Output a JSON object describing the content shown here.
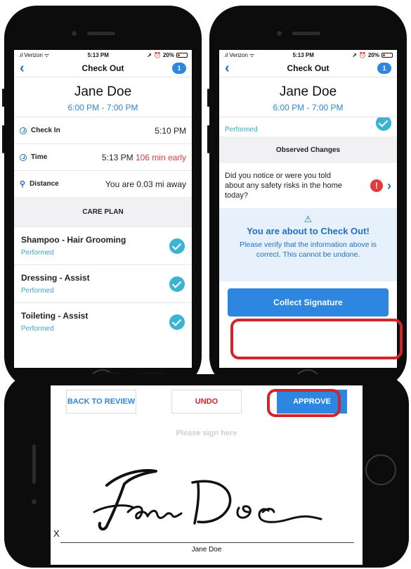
{
  "status_bar": {
    "carrier": "Verizon",
    "time": "5:13 PM",
    "battery": "20%"
  },
  "nav": {
    "title": "Check Out",
    "badge": "1"
  },
  "client": {
    "name": "Jane Doe",
    "time_range": "6:00 PM - 7:00 PM"
  },
  "visit": {
    "check_in_label": "Check In",
    "check_in_value": "5:10 PM",
    "time_label": "Time",
    "time_value": "5:13 PM",
    "time_early": "106 min early",
    "distance_label": "Distance",
    "distance_value": "You are 0.03 mi away"
  },
  "care_plan": {
    "header": "CARE PLAN",
    "items": [
      {
        "title": "Shampoo - Hair Grooming",
        "status": "Performed"
      },
      {
        "title": "Dressing - Assist",
        "status": "Performed"
      },
      {
        "title": "Toileting - Assist",
        "status": "Performed"
      }
    ],
    "partial_status": "Performed"
  },
  "observed_changes": {
    "header": "Observed Changes",
    "question": "Did you notice or were you told about any safety risks in the home today?",
    "alert_glyph": "!"
  },
  "warning": {
    "icon": "⚠",
    "title": "You are about to Check Out!",
    "body": "Please verify that the information above is correct. This cannot be undone."
  },
  "collect_signature_label": "Collect Signature",
  "signature_screen": {
    "back_label": "BACK TO REVIEW",
    "undo_label": "UNDO",
    "approve_label": "APPROVE",
    "prompt": "Please sign here",
    "x_mark": "X",
    "signer_name": "Jane Doe"
  },
  "colors": {
    "accent": "#2d86e0",
    "highlight": "#d3242c",
    "success": "#3bb3d1",
    "alert": "#e23b3b"
  }
}
